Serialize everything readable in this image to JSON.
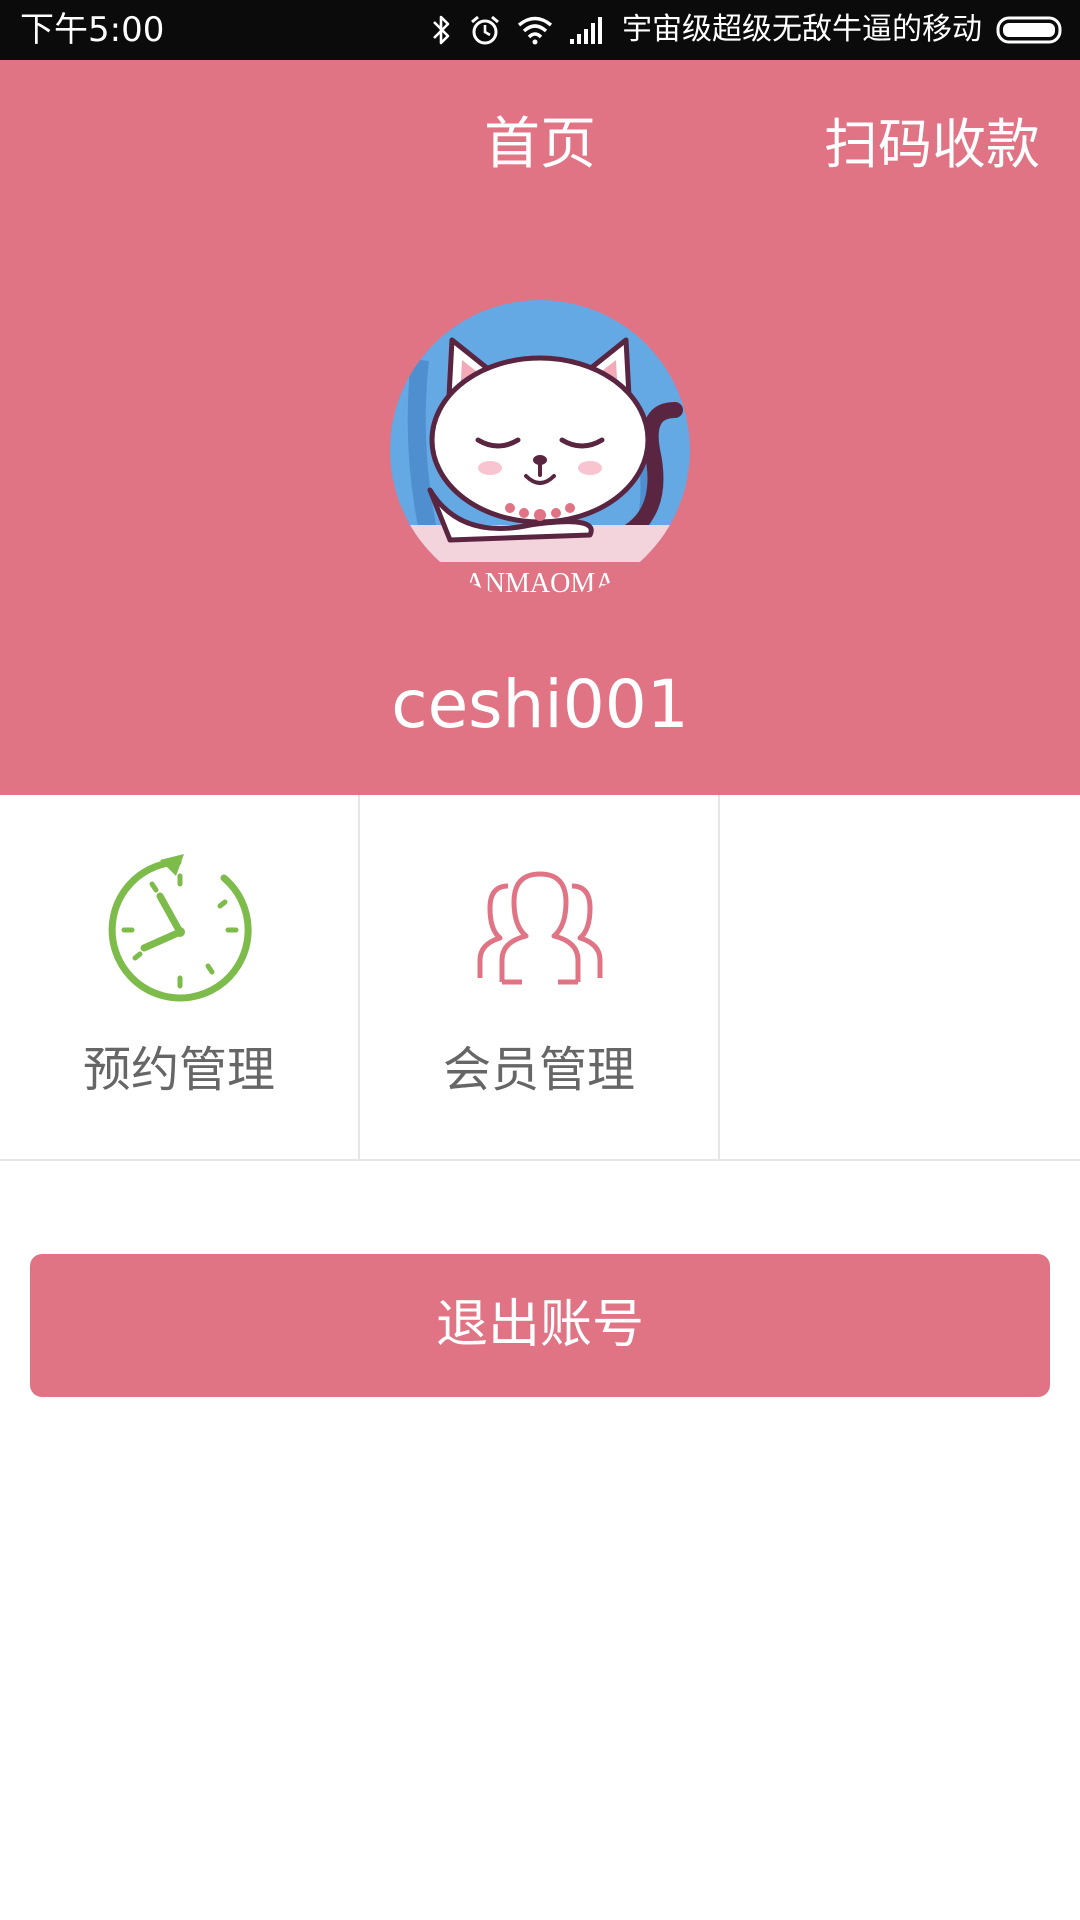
{
  "status_bar": {
    "time": "下午5:00",
    "carrier": "宇宙级超级无敌牛逼的移动",
    "icons": [
      "bluetooth-icon",
      "alarm-icon",
      "wifi-icon",
      "signal-icon",
      "battery-icon"
    ]
  },
  "header": {
    "title": "首页",
    "scan_label": "扫码收款",
    "username": "ceshi001",
    "avatar_caption": "ANMAOMA",
    "background": "#e07485"
  },
  "grid": {
    "items": [
      {
        "label": "预约管理",
        "icon": "clock-icon",
        "color": "#7dbb4a"
      },
      {
        "label": "会员管理",
        "icon": "members-icon",
        "color": "#e07485"
      },
      {
        "label": "",
        "icon": ""
      }
    ]
  },
  "logout": {
    "label": "退出账号",
    "color": "#e07485"
  }
}
